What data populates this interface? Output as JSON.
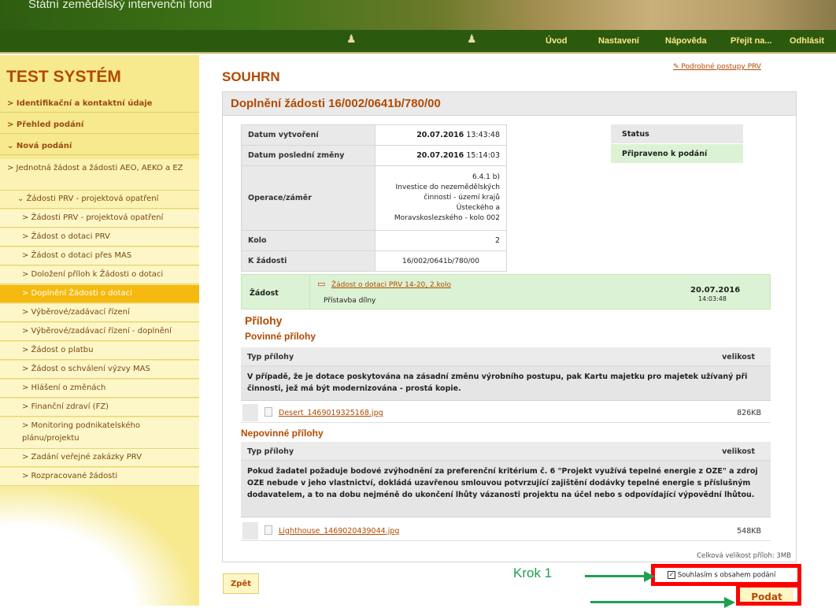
{
  "header": {
    "brand": "Státní zemědělský intervenční fond"
  },
  "nav": [
    "Úvod",
    "Nastavení",
    "Nápověda",
    "Přejít na...",
    "Odhlásit"
  ],
  "sidebar": {
    "title": "TEST SYSTÉM",
    "items": [
      "> Identifikační a kontaktní údaje",
      "> Přehled podání",
      "⌄ Nová podání",
      "> Jednotná žádost a žádosti AEO, AEKO a EZ",
      "⌄ Žádosti PRV - projektová opatření",
      "> Žádosti PRV - projektová opatření",
      "> Žádost o dotaci PRV",
      "> Žádost o dotaci přes MAS",
      "> Doložení příloh k Žádosti o dotaci",
      "> Doplnění Žádosti o dotaci",
      "> Výběrové/zadávací řízení",
      "> Výběrové/zadávací řízení - doplnění",
      "> Žádost o platbu",
      "> Žádost o schválení výzvy MAS",
      "> Hlášení o změnách",
      "> Finanční zdraví (FZ)",
      "> Monitoring podnikatelského plánu/projektu",
      "> Zadání veřejné zakázky PRV",
      "> Rozpracované žádosti"
    ]
  },
  "main": {
    "heading": "SOUHRN",
    "help_link": "Podrobné postupy PRV",
    "box_title": "Doplnění žádosti 16/002/0641b/780/00",
    "info": [
      {
        "label": "Datum vytvoření",
        "date": "20.07.2016",
        "time": "13:43:48"
      },
      {
        "label": "Datum poslední změny",
        "date": "20.07.2016",
        "time": "15:14:03"
      },
      {
        "label": "Operace/záměr",
        "value": [
          "6.4.1 b)",
          "Investice do nezemědělských",
          "činností - území krajů",
          "Ústeckého a",
          "Moravskoslezského - kolo 002"
        ]
      },
      {
        "label": "Kolo",
        "value": "2"
      },
      {
        "label": "K žádosti",
        "value": "16/002/0641b/780/00"
      }
    ],
    "status_label": "Status",
    "status_value": "Připraveno k podání",
    "zadost": {
      "label": "Žádost",
      "link": "Žádost o dotaci PRV 14-20, 2.kolo",
      "sub": "Přístavba dílny",
      "date": "20.07.2016",
      "time": "14:03:48"
    },
    "prilohy": "Přílohy",
    "povinne": "Povinné přílohy",
    "nepovinne": "Nepovinné přílohy",
    "col_type": "Typ přílohy",
    "col_size": "velikost",
    "pov_desc": "V případě, že je dotace poskytována na zásadní změnu výrobního postupu, pak Kartu majetku pro majetek užívaný při činnosti, jež má být modernizována - prostá kopie.",
    "pov_file": "Desert_1469019325168.jpg",
    "pov_size": "826KB",
    "nepov_desc": "Pokud žadatel požaduje bodové zvýhodnění za preferenční kritérium č. 6 \"Projekt využívá tepelné energie z OZE\" a zdroj OZE nebude v jeho vlastnictví, dokládá uzavřenou smlouvou potvrzující zajištění dodávky tepelné energie s příslušným dodavatelem, a to na dobu nejméně do ukončení lhůty vázanosti projektu na účel nebo s odpovídající výpovědní lhůtou.",
    "nepov_file": "Lighthouse_1469020439044.jpg",
    "nepov_size": "548KB",
    "total": "Celková velikost příloh: 3MB",
    "consent": "Souhlasím s obsahem podání",
    "back": "Zpět",
    "submit": "Podat"
  },
  "annotation": {
    "step1": "Krok 1",
    "color": "#1fa050",
    "highlight": "#ff0000"
  }
}
